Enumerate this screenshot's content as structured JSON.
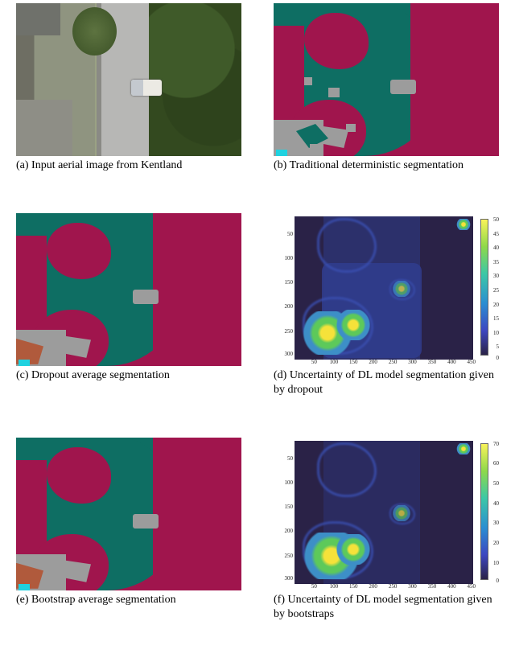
{
  "panels": {
    "a": {
      "caption": "(a) Input aerial image from Kentland"
    },
    "b": {
      "caption": "(b) Traditional deterministic segmentation"
    },
    "c": {
      "caption": "(c) Dropout average segmentation"
    },
    "d": {
      "caption": "(d) Uncertainty of DL model segmentation given by dropout"
    },
    "e": {
      "caption": "(e) Bootstrap average segmentation"
    },
    "f": {
      "caption": "(f) Uncertainty of DL model segmentation given by bootstraps"
    }
  },
  "axes": {
    "d": {
      "y_ticks": [
        "50",
        "100",
        "150",
        "200",
        "250",
        "300"
      ],
      "x_ticks": [
        "50",
        "100",
        "150",
        "200",
        "250",
        "300",
        "350",
        "400",
        "450"
      ],
      "cbar_ticks": [
        "50",
        "45",
        "40",
        "35",
        "30",
        "25",
        "20",
        "15",
        "10",
        "5",
        "0"
      ]
    },
    "f": {
      "y_ticks": [
        "50",
        "100",
        "150",
        "200",
        "250",
        "300"
      ],
      "x_ticks": [
        "50",
        "100",
        "150",
        "200",
        "250",
        "300",
        "350",
        "400",
        "450"
      ],
      "cbar_ticks": [
        "70",
        "60",
        "50",
        "40",
        "30",
        "20",
        "10",
        "0"
      ]
    }
  },
  "seg_palette": {
    "background": "#a0154d",
    "road_vegetation": "#0e6e63",
    "object_gray_1": "#9c9c9c",
    "object_gray_2": "#7d7d7d",
    "roof_brown": "#b05a3c",
    "cyan": "#1fd2e0"
  },
  "heat_palette": {
    "low": "#2a2247",
    "mid": "#3d8fc7",
    "high": "#f5e23a"
  }
}
